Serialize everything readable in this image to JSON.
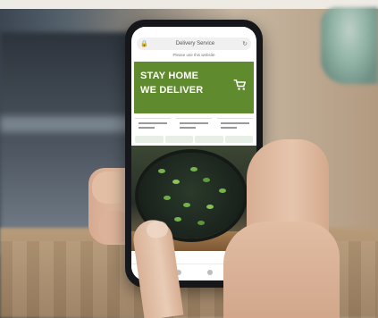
{
  "scene": {
    "description": "",
    "colors": {
      "hero_green": "#5f8a2d",
      "phone_body": "#15171a"
    }
  },
  "phone_screen": {
    "address_bar": {
      "text": "Delivery Service",
      "left_icon": "lock-icon",
      "right_icon": "reload-icon"
    },
    "notice_text": "Please use this website",
    "hero": {
      "line1": "STAY HOME",
      "line2": "WE DELIVER",
      "icon": "shopping-cart-icon"
    }
  }
}
